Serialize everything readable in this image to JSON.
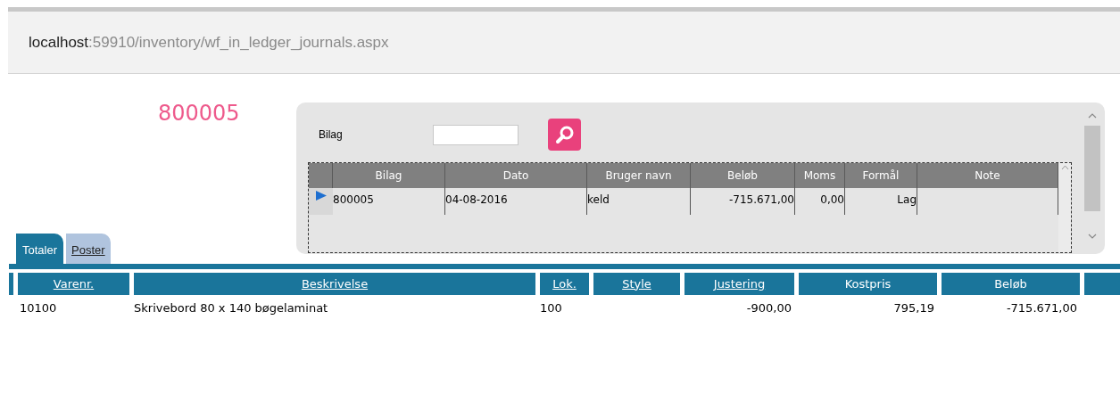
{
  "address_bar": {
    "host": "localhost",
    "path": ":59910/inventory/wf_in_ledger_journals.aspx"
  },
  "journal_number": "800005",
  "search_panel": {
    "label": "Bilag",
    "grid": {
      "columns": [
        "Bilag",
        "Dato",
        "Bruger navn",
        "Beløb",
        "Moms",
        "Formål",
        "Note"
      ],
      "rows": [
        {
          "current": true,
          "cells": [
            "800005",
            "04-08-2016",
            "keld",
            "-715.671,00",
            "0,00",
            "Lag",
            ""
          ]
        }
      ]
    }
  },
  "tabs": [
    {
      "label": "Totaler",
      "selected": true
    },
    {
      "label": "Poster",
      "selected": false
    }
  ],
  "table": {
    "columns": [
      {
        "label": "Varenr.",
        "sortable": true
      },
      {
        "label": "Beskrivelse",
        "sortable": true
      },
      {
        "label": "Lok.",
        "sortable": true
      },
      {
        "label": "Style",
        "sortable": true
      },
      {
        "label": "Justering",
        "sortable": true
      },
      {
        "label": "Kostpris",
        "sortable": false
      },
      {
        "label": "Beløb",
        "sortable": false
      }
    ],
    "rows": [
      [
        "10100",
        "Skrivebord 80 x 140 bøgelaminat",
        "100",
        "",
        "-900,00",
        "795,19",
        "-715.671,00"
      ]
    ]
  }
}
